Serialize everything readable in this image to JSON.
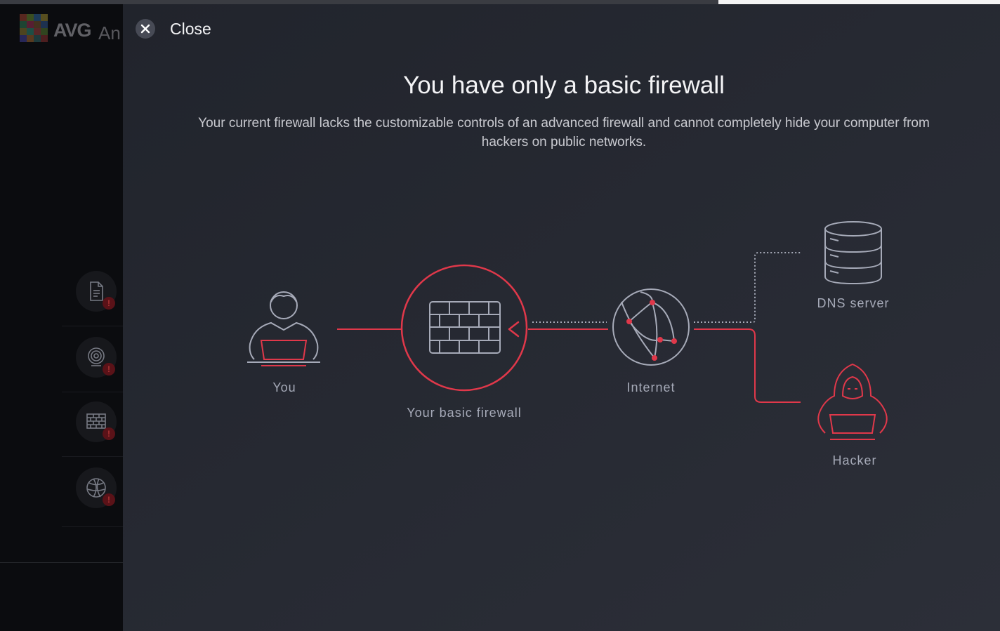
{
  "app": {
    "logo_text": "AVG",
    "logo_text_cropped": "An"
  },
  "close": {
    "label": "Close"
  },
  "dialog": {
    "title": "You have only a basic firewall",
    "subtitle": "Your current firewall lacks the customizable controls of an advanced firewall and cannot completely hide your computer from hackers on public networks."
  },
  "diagram": {
    "you": "You",
    "firewall": "Your basic firewall",
    "internet": "Internet",
    "dns": "DNS server",
    "hacker": "Hacker"
  },
  "sidebar": {
    "items": [
      {
        "icon": "document-icon",
        "badge": "!"
      },
      {
        "icon": "webcam-icon",
        "badge": "!"
      },
      {
        "icon": "firewall-icon",
        "badge": "!"
      },
      {
        "icon": "globe-icon",
        "badge": "!"
      }
    ]
  },
  "colors": {
    "accent_red": "#e0384a",
    "line_blue": "#a6aab8",
    "panel_bg": "#262931"
  }
}
